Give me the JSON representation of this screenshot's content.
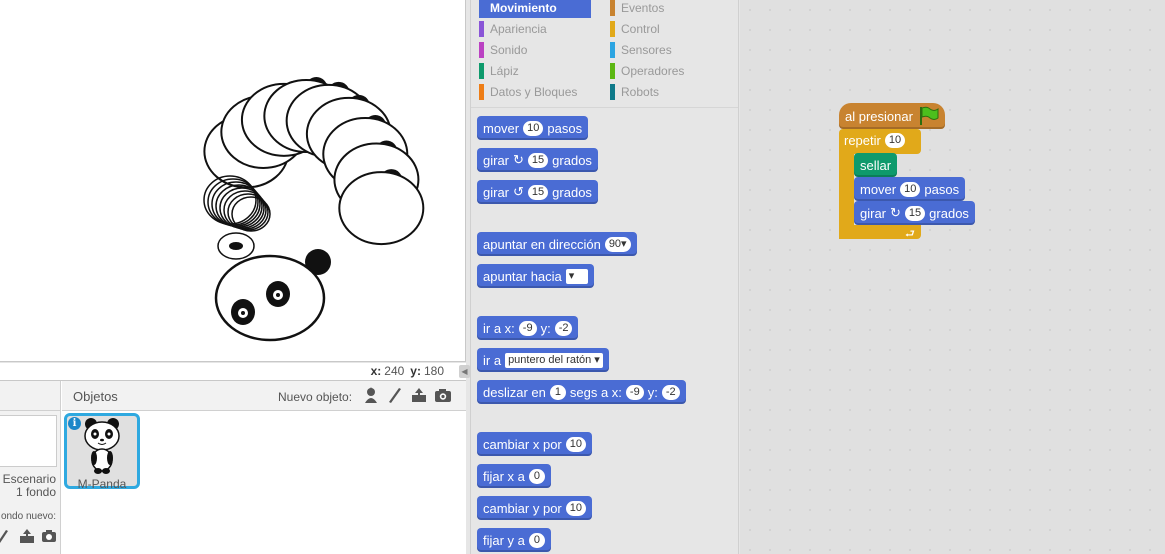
{
  "stage": {
    "coords": {
      "x_label": "x:",
      "x_value": "240",
      "y_label": "y:",
      "y_value": "180"
    }
  },
  "sprite_panel": {
    "objects_title": "Objetos",
    "new_object_label": "Nuevo objeto:",
    "new_object_tools": [
      "paint-icon",
      "brush-icon",
      "upload-icon",
      "camera-icon"
    ],
    "stage_label_line1": "Escenario",
    "stage_label_line2": "1 fondo",
    "new_backdrop_label": "ondo nuevo:",
    "sprite_name": "M-Panda",
    "info_glyph": "i"
  },
  "palette": {
    "categories": [
      {
        "label": "Movimiento",
        "color": "#4a6cd4",
        "selected": true
      },
      {
        "label": "Apariencia",
        "color": "#8a55d7"
      },
      {
        "label": "Sonido",
        "color": "#bb42c3"
      },
      {
        "label": "Lápiz",
        "color": "#0e9a6c"
      },
      {
        "label": "Datos y Bloques",
        "color": "#ee7d16"
      },
      {
        "label": "Eventos",
        "color": "#c88330"
      },
      {
        "label": "Control",
        "color": "#e1a91a"
      },
      {
        "label": "Sensores",
        "color": "#2ca5e2"
      },
      {
        "label": "Operadores",
        "color": "#5cb712"
      },
      {
        "label": "Robots",
        "color": "#0f7a8a"
      }
    ],
    "blocks": {
      "move": {
        "t1": "mover",
        "n1": "10",
        "t2": "pasos"
      },
      "turn_right": {
        "t1": "girar",
        "icon": "↻",
        "n1": "15",
        "t2": "grados"
      },
      "turn_left": {
        "t1": "girar",
        "icon": "↺",
        "n1": "15",
        "t2": "grados"
      },
      "point_dir": {
        "t1": "apuntar en dirección",
        "n1": "90▾"
      },
      "point_to": {
        "t1": "apuntar hacia",
        "d1": "▾"
      },
      "goto_xy": {
        "t1": "ir a x:",
        "n1": "-9",
        "t2": "y:",
        "n2": "-2"
      },
      "goto": {
        "t1": "ir a",
        "d1": "puntero del ratón ▾"
      },
      "glide": {
        "t1": "deslizar en",
        "n1": "1",
        "t2": "segs a x:",
        "n2": "-9",
        "t3": "y:",
        "n3": "-2"
      },
      "change_x": {
        "t1": "cambiar x por",
        "n1": "10"
      },
      "set_x": {
        "t1": "fijar x a",
        "n1": "0"
      },
      "change_y": {
        "t1": "cambiar y por",
        "n1": "10"
      },
      "set_y": {
        "t1": "fijar y a",
        "n1": "0"
      }
    }
  },
  "script": {
    "hat": {
      "t1": "al presionar"
    },
    "repeat": {
      "t1": "repetir",
      "n1": "10",
      "loop_icon": "⮐"
    },
    "stamp": {
      "t1": "sellar"
    },
    "move": {
      "t1": "mover",
      "n1": "10",
      "t2": "pasos"
    },
    "turn": {
      "t1": "girar",
      "icon": "↻",
      "n1": "15",
      "t2": "grados"
    }
  }
}
